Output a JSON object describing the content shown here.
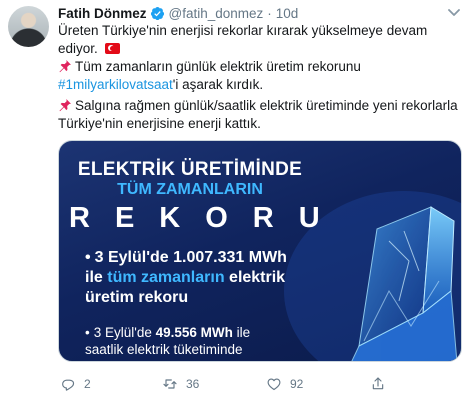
{
  "author": {
    "name": "Fatih Dönmez",
    "handle": "@fatih_donmez",
    "separator": "·",
    "time": "10d"
  },
  "tweet": {
    "line1": "Üreten Türkiye'nin enerjisi rekorlar kırarak yükselmeye devam ediyor.",
    "para2_before": "Tüm zamanların günlük elektrik üretim rekorunu ",
    "para2_hashtag": "#1milyarkilovatsaat",
    "para2_after": "'i aşarak kırdık.",
    "para3": "Salgına rağmen günlük/saatlik elektrik üretiminde yeni rekorlarla Türkiye'nin enerjisine enerji kattık."
  },
  "media": {
    "heading1": "ELEKTRİK ÜRETİMİNDE",
    "heading2": "TÜM ZAMANLARIN",
    "heading3": "REKORU",
    "bullet_mark": "•",
    "bullet1_pre": "3 Eylül'de 1.007.331 MWh",
    "bullet1_mid_pre": "ile ",
    "bullet1_hl": "tüm zamanların",
    "bullet1_mid_post": " elektrik",
    "bullet1_post": "üretim rekoru",
    "bullet2_pre": "3 Eylül'de ",
    "bullet2_strong": "49.556 MWh",
    "bullet2_post": " ile",
    "bullet2_line2": "saatlik elektrik tüketiminde"
  },
  "actions": {
    "reply_count": "2",
    "retweet_count": "36",
    "like_count": "92"
  },
  "colors": {
    "link": "#1b95e0",
    "muted": "#657786",
    "verified": "#1da1f2",
    "media_bg": "#10245e",
    "media_accent": "#3fb8ff"
  },
  "icons": [
    "verified-badge-icon",
    "caret-down-icon",
    "pin-icon",
    "turkey-flag-icon",
    "reply-icon",
    "retweet-icon",
    "like-icon",
    "share-icon"
  ]
}
